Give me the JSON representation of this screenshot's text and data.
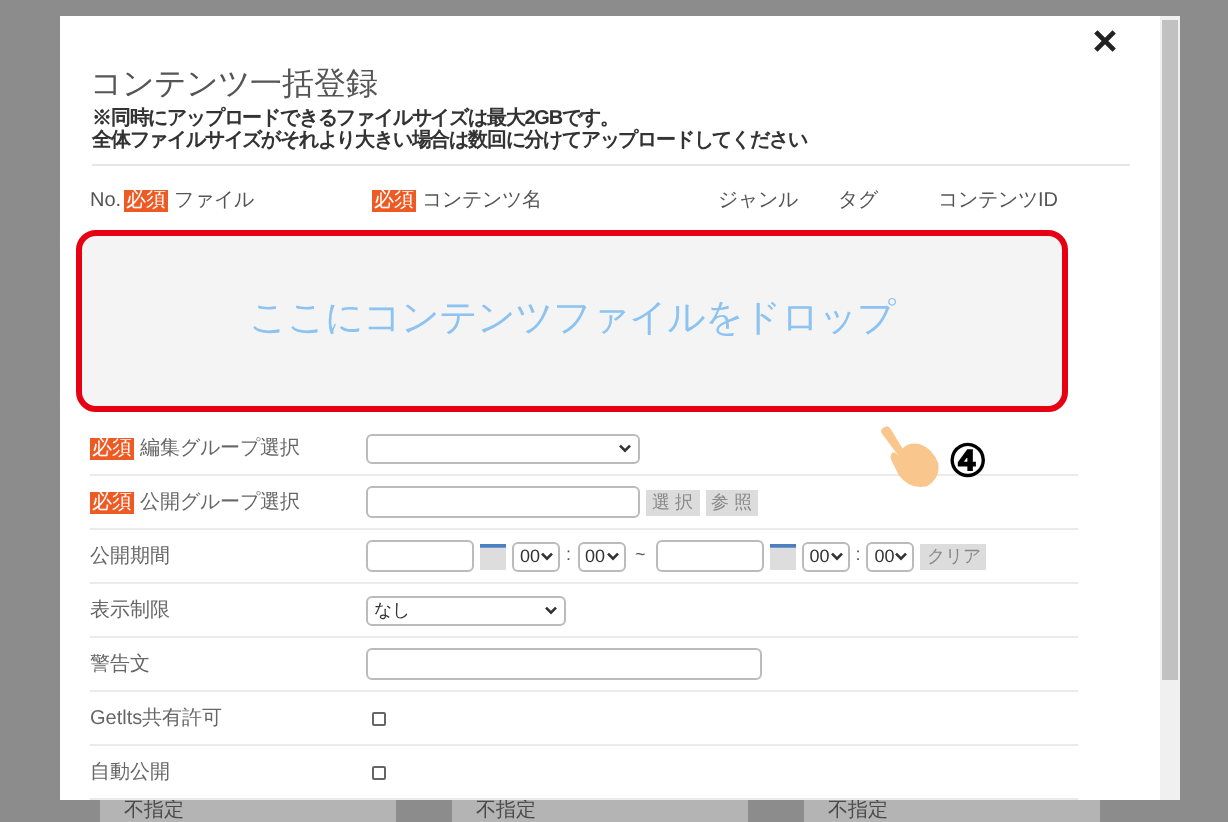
{
  "dialog": {
    "title": "コンテンツ一括登録",
    "notes": [
      "※同時にアップロードできるファイルサイズは最大2GBです。",
      "全体ファイルサイズがそれより大きい場合は数回に分けてアップロードしてください"
    ],
    "columns": [
      {
        "label": "No."
      },
      {
        "label": "ファイル",
        "badge": "必須"
      },
      {
        "label": "コンテンツ名",
        "badge": "必須"
      },
      {
        "label": "ジャンル"
      },
      {
        "label": "タグ"
      },
      {
        "label": "コンテンツID"
      }
    ],
    "drop_zone": {
      "text": "ここにコンテンツファイルをドロップ",
      "highlighted": true
    },
    "callout": "④",
    "fields": [
      {
        "kind": "select",
        "label": "編集グループ選択",
        "badge": "必須"
      },
      {
        "kind": "picker",
        "label": "公開グループ選択",
        "badge": "必須",
        "buttons": [
          "選 択",
          "参 照"
        ]
      },
      {
        "kind": "period",
        "label": "公開期間",
        "start": {
          "hour": "00",
          "separator": ":",
          "minute": "00"
        },
        "range_mark": "~",
        "end": {
          "hour": "00",
          "separator": ":",
          "minute": "00"
        },
        "button": "クリア"
      },
      {
        "kind": "select",
        "label": "表示制限",
        "value": "なし"
      },
      {
        "kind": "text",
        "label": "警告文"
      },
      {
        "kind": "checkbox",
        "label": "Getlts共有許可",
        "checked": false
      },
      {
        "kind": "checkbox",
        "label": "自動公開",
        "checked": false
      }
    ]
  },
  "background_labels": [
    "不指定",
    "不指定",
    "不指定"
  ]
}
